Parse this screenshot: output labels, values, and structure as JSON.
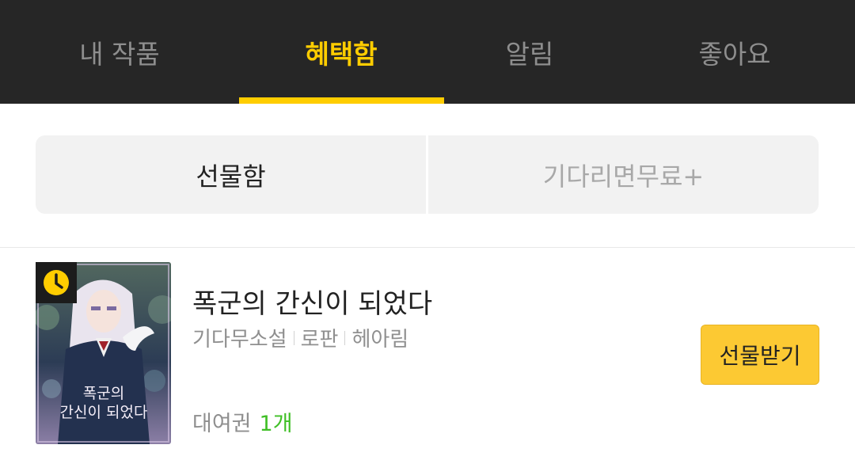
{
  "top_tabs": [
    {
      "label": "내 작품",
      "active": false
    },
    {
      "label": "혜택함",
      "active": true
    },
    {
      "label": "알림",
      "active": false
    },
    {
      "label": "좋아요",
      "active": false
    }
  ],
  "segment": {
    "left_label": "선물함",
    "right_label": "기다리면무료+",
    "selected": "선물함"
  },
  "item": {
    "title": "폭군의 간신이 되었다",
    "meta": [
      "기다무소설",
      "로판",
      "헤아림"
    ],
    "cover_text": "폭군의 간신이 되었다",
    "cover_badge_icon": "clock-icon",
    "ticket_label": "대여권",
    "ticket_count": "1개",
    "action_label": "선물받기"
  },
  "colors": {
    "accent": "#ffcd00",
    "nav_bg": "#262626",
    "count_green": "#3fbf25",
    "button_yellow": "#fcc933"
  }
}
